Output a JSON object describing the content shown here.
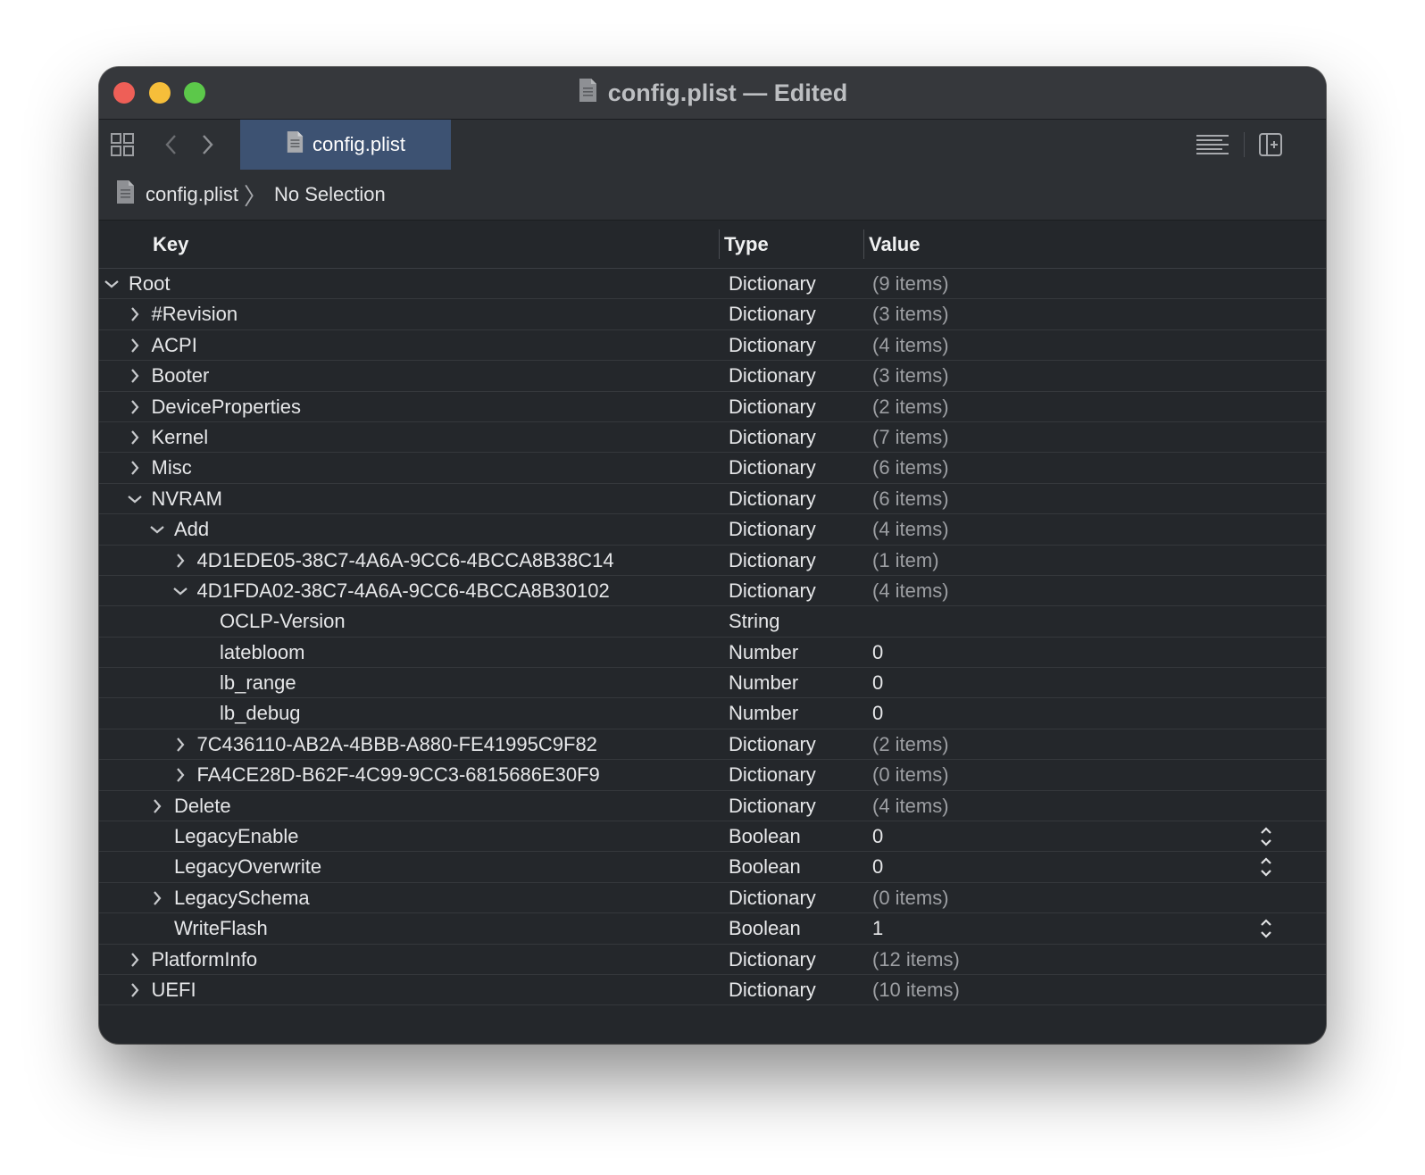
{
  "window": {
    "title": "config.plist — Edited"
  },
  "toolbar": {
    "tab_label": "config.plist",
    "icons": [
      "grid-icon",
      "back-chevron-icon",
      "forward-chevron-icon",
      "lines-icon",
      "add-panel-icon"
    ]
  },
  "breadcrumb": {
    "file": "config.plist",
    "selection": "No Selection"
  },
  "columns": {
    "key": "Key",
    "type": "Type",
    "value": "Value"
  },
  "rows": [
    {
      "key": "Root",
      "type": "Dictionary",
      "value": "(9 items)",
      "level": 0,
      "disclosure": "expanded",
      "stepper": false
    },
    {
      "key": "#Revision",
      "type": "Dictionary",
      "value": "(3 items)",
      "level": 1,
      "disclosure": "collapsed",
      "stepper": false
    },
    {
      "key": "ACPI",
      "type": "Dictionary",
      "value": "(4 items)",
      "level": 1,
      "disclosure": "collapsed",
      "stepper": false
    },
    {
      "key": "Booter",
      "type": "Dictionary",
      "value": "(3 items)",
      "level": 1,
      "disclosure": "collapsed",
      "stepper": false
    },
    {
      "key": "DeviceProperties",
      "type": "Dictionary",
      "value": "(2 items)",
      "level": 1,
      "disclosure": "collapsed",
      "stepper": false
    },
    {
      "key": "Kernel",
      "type": "Dictionary",
      "value": "(7 items)",
      "level": 1,
      "disclosure": "collapsed",
      "stepper": false
    },
    {
      "key": "Misc",
      "type": "Dictionary",
      "value": "(6 items)",
      "level": 1,
      "disclosure": "collapsed",
      "stepper": false
    },
    {
      "key": "NVRAM",
      "type": "Dictionary",
      "value": "(6 items)",
      "level": 1,
      "disclosure": "expanded",
      "stepper": false
    },
    {
      "key": "Add",
      "type": "Dictionary",
      "value": "(4 items)",
      "level": 2,
      "disclosure": "expanded",
      "stepper": false
    },
    {
      "key": "4D1EDE05-38C7-4A6A-9CC6-4BCCA8B38C14",
      "type": "Dictionary",
      "value": "(1 item)",
      "level": 3,
      "disclosure": "collapsed",
      "stepper": false
    },
    {
      "key": "4D1FDA02-38C7-4A6A-9CC6-4BCCA8B30102",
      "type": "Dictionary",
      "value": "(4 items)",
      "level": 3,
      "disclosure": "expanded",
      "stepper": false
    },
    {
      "key": "OCLP-Version",
      "type": "String",
      "value": "",
      "level": 4,
      "disclosure": "none",
      "stepper": false
    },
    {
      "key": "latebloom",
      "type": "Number",
      "value": "0",
      "level": 4,
      "disclosure": "none",
      "stepper": false
    },
    {
      "key": "lb_range",
      "type": "Number",
      "value": "0",
      "level": 4,
      "disclosure": "none",
      "stepper": false
    },
    {
      "key": "lb_debug",
      "type": "Number",
      "value": "0",
      "level": 4,
      "disclosure": "none",
      "stepper": false
    },
    {
      "key": "7C436110-AB2A-4BBB-A880-FE41995C9F82",
      "type": "Dictionary",
      "value": "(2 items)",
      "level": 3,
      "disclosure": "collapsed",
      "stepper": false
    },
    {
      "key": "FA4CE28D-B62F-4C99-9CC3-6815686E30F9",
      "type": "Dictionary",
      "value": "(0 items)",
      "level": 3,
      "disclosure": "collapsed",
      "stepper": false
    },
    {
      "key": "Delete",
      "type": "Dictionary",
      "value": "(4 items)",
      "level": 2,
      "disclosure": "collapsed",
      "stepper": false
    },
    {
      "key": "LegacyEnable",
      "type": "Boolean",
      "value": "0",
      "level": 2,
      "disclosure": "none",
      "stepper": true
    },
    {
      "key": "LegacyOverwrite",
      "type": "Boolean",
      "value": "0",
      "level": 2,
      "disclosure": "none",
      "stepper": true
    },
    {
      "key": "LegacySchema",
      "type": "Dictionary",
      "value": "(0 items)",
      "level": 2,
      "disclosure": "collapsed",
      "stepper": false
    },
    {
      "key": "WriteFlash",
      "type": "Boolean",
      "value": "1",
      "level": 2,
      "disclosure": "none",
      "stepper": true
    },
    {
      "key": "PlatformInfo",
      "type": "Dictionary",
      "value": "(12 items)",
      "level": 1,
      "disclosure": "collapsed",
      "stepper": false
    },
    {
      "key": "UEFI",
      "type": "Dictionary",
      "value": "(10 items)",
      "level": 1,
      "disclosure": "collapsed",
      "stepper": false
    }
  ],
  "colors": {
    "accent_tab": "#3d5272",
    "close": "#ee5f57",
    "minimize": "#f6be3a",
    "zoom": "#5cc84a"
  }
}
